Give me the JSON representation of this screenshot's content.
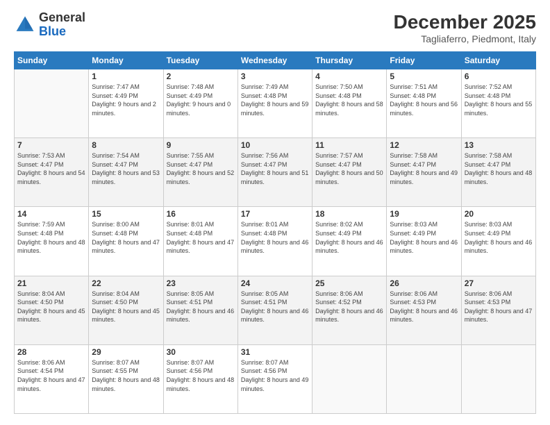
{
  "header": {
    "logo_general": "General",
    "logo_blue": "Blue",
    "month_title": "December 2025",
    "location": "Tagliaferro, Piedmont, Italy"
  },
  "weekdays": [
    "Sunday",
    "Monday",
    "Tuesday",
    "Wednesday",
    "Thursday",
    "Friday",
    "Saturday"
  ],
  "weeks": [
    [
      {
        "day": "",
        "sunrise": "",
        "sunset": "",
        "daylight": ""
      },
      {
        "day": "1",
        "sunrise": "Sunrise: 7:47 AM",
        "sunset": "Sunset: 4:49 PM",
        "daylight": "Daylight: 9 hours and 2 minutes."
      },
      {
        "day": "2",
        "sunrise": "Sunrise: 7:48 AM",
        "sunset": "Sunset: 4:49 PM",
        "daylight": "Daylight: 9 hours and 0 minutes."
      },
      {
        "day": "3",
        "sunrise": "Sunrise: 7:49 AM",
        "sunset": "Sunset: 4:48 PM",
        "daylight": "Daylight: 8 hours and 59 minutes."
      },
      {
        "day": "4",
        "sunrise": "Sunrise: 7:50 AM",
        "sunset": "Sunset: 4:48 PM",
        "daylight": "Daylight: 8 hours and 58 minutes."
      },
      {
        "day": "5",
        "sunrise": "Sunrise: 7:51 AM",
        "sunset": "Sunset: 4:48 PM",
        "daylight": "Daylight: 8 hours and 56 minutes."
      },
      {
        "day": "6",
        "sunrise": "Sunrise: 7:52 AM",
        "sunset": "Sunset: 4:48 PM",
        "daylight": "Daylight: 8 hours and 55 minutes."
      }
    ],
    [
      {
        "day": "7",
        "sunrise": "Sunrise: 7:53 AM",
        "sunset": "Sunset: 4:47 PM",
        "daylight": "Daylight: 8 hours and 54 minutes."
      },
      {
        "day": "8",
        "sunrise": "Sunrise: 7:54 AM",
        "sunset": "Sunset: 4:47 PM",
        "daylight": "Daylight: 8 hours and 53 minutes."
      },
      {
        "day": "9",
        "sunrise": "Sunrise: 7:55 AM",
        "sunset": "Sunset: 4:47 PM",
        "daylight": "Daylight: 8 hours and 52 minutes."
      },
      {
        "day": "10",
        "sunrise": "Sunrise: 7:56 AM",
        "sunset": "Sunset: 4:47 PM",
        "daylight": "Daylight: 8 hours and 51 minutes."
      },
      {
        "day": "11",
        "sunrise": "Sunrise: 7:57 AM",
        "sunset": "Sunset: 4:47 PM",
        "daylight": "Daylight: 8 hours and 50 minutes."
      },
      {
        "day": "12",
        "sunrise": "Sunrise: 7:58 AM",
        "sunset": "Sunset: 4:47 PM",
        "daylight": "Daylight: 8 hours and 49 minutes."
      },
      {
        "day": "13",
        "sunrise": "Sunrise: 7:58 AM",
        "sunset": "Sunset: 4:47 PM",
        "daylight": "Daylight: 8 hours and 48 minutes."
      }
    ],
    [
      {
        "day": "14",
        "sunrise": "Sunrise: 7:59 AM",
        "sunset": "Sunset: 4:48 PM",
        "daylight": "Daylight: 8 hours and 48 minutes."
      },
      {
        "day": "15",
        "sunrise": "Sunrise: 8:00 AM",
        "sunset": "Sunset: 4:48 PM",
        "daylight": "Daylight: 8 hours and 47 minutes."
      },
      {
        "day": "16",
        "sunrise": "Sunrise: 8:01 AM",
        "sunset": "Sunset: 4:48 PM",
        "daylight": "Daylight: 8 hours and 47 minutes."
      },
      {
        "day": "17",
        "sunrise": "Sunrise: 8:01 AM",
        "sunset": "Sunset: 4:48 PM",
        "daylight": "Daylight: 8 hours and 46 minutes."
      },
      {
        "day": "18",
        "sunrise": "Sunrise: 8:02 AM",
        "sunset": "Sunset: 4:49 PM",
        "daylight": "Daylight: 8 hours and 46 minutes."
      },
      {
        "day": "19",
        "sunrise": "Sunrise: 8:03 AM",
        "sunset": "Sunset: 4:49 PM",
        "daylight": "Daylight: 8 hours and 46 minutes."
      },
      {
        "day": "20",
        "sunrise": "Sunrise: 8:03 AM",
        "sunset": "Sunset: 4:49 PM",
        "daylight": "Daylight: 8 hours and 46 minutes."
      }
    ],
    [
      {
        "day": "21",
        "sunrise": "Sunrise: 8:04 AM",
        "sunset": "Sunset: 4:50 PM",
        "daylight": "Daylight: 8 hours and 45 minutes."
      },
      {
        "day": "22",
        "sunrise": "Sunrise: 8:04 AM",
        "sunset": "Sunset: 4:50 PM",
        "daylight": "Daylight: 8 hours and 45 minutes."
      },
      {
        "day": "23",
        "sunrise": "Sunrise: 8:05 AM",
        "sunset": "Sunset: 4:51 PM",
        "daylight": "Daylight: 8 hours and 46 minutes."
      },
      {
        "day": "24",
        "sunrise": "Sunrise: 8:05 AM",
        "sunset": "Sunset: 4:51 PM",
        "daylight": "Daylight: 8 hours and 46 minutes."
      },
      {
        "day": "25",
        "sunrise": "Sunrise: 8:06 AM",
        "sunset": "Sunset: 4:52 PM",
        "daylight": "Daylight: 8 hours and 46 minutes."
      },
      {
        "day": "26",
        "sunrise": "Sunrise: 8:06 AM",
        "sunset": "Sunset: 4:53 PM",
        "daylight": "Daylight: 8 hours and 46 minutes."
      },
      {
        "day": "27",
        "sunrise": "Sunrise: 8:06 AM",
        "sunset": "Sunset: 4:53 PM",
        "daylight": "Daylight: 8 hours and 47 minutes."
      }
    ],
    [
      {
        "day": "28",
        "sunrise": "Sunrise: 8:06 AM",
        "sunset": "Sunset: 4:54 PM",
        "daylight": "Daylight: 8 hours and 47 minutes."
      },
      {
        "day": "29",
        "sunrise": "Sunrise: 8:07 AM",
        "sunset": "Sunset: 4:55 PM",
        "daylight": "Daylight: 8 hours and 48 minutes."
      },
      {
        "day": "30",
        "sunrise": "Sunrise: 8:07 AM",
        "sunset": "Sunset: 4:56 PM",
        "daylight": "Daylight: 8 hours and 48 minutes."
      },
      {
        "day": "31",
        "sunrise": "Sunrise: 8:07 AM",
        "sunset": "Sunset: 4:56 PM",
        "daylight": "Daylight: 8 hours and 49 minutes."
      },
      {
        "day": "",
        "sunrise": "",
        "sunset": "",
        "daylight": ""
      },
      {
        "day": "",
        "sunrise": "",
        "sunset": "",
        "daylight": ""
      },
      {
        "day": "",
        "sunrise": "",
        "sunset": "",
        "daylight": ""
      }
    ]
  ]
}
